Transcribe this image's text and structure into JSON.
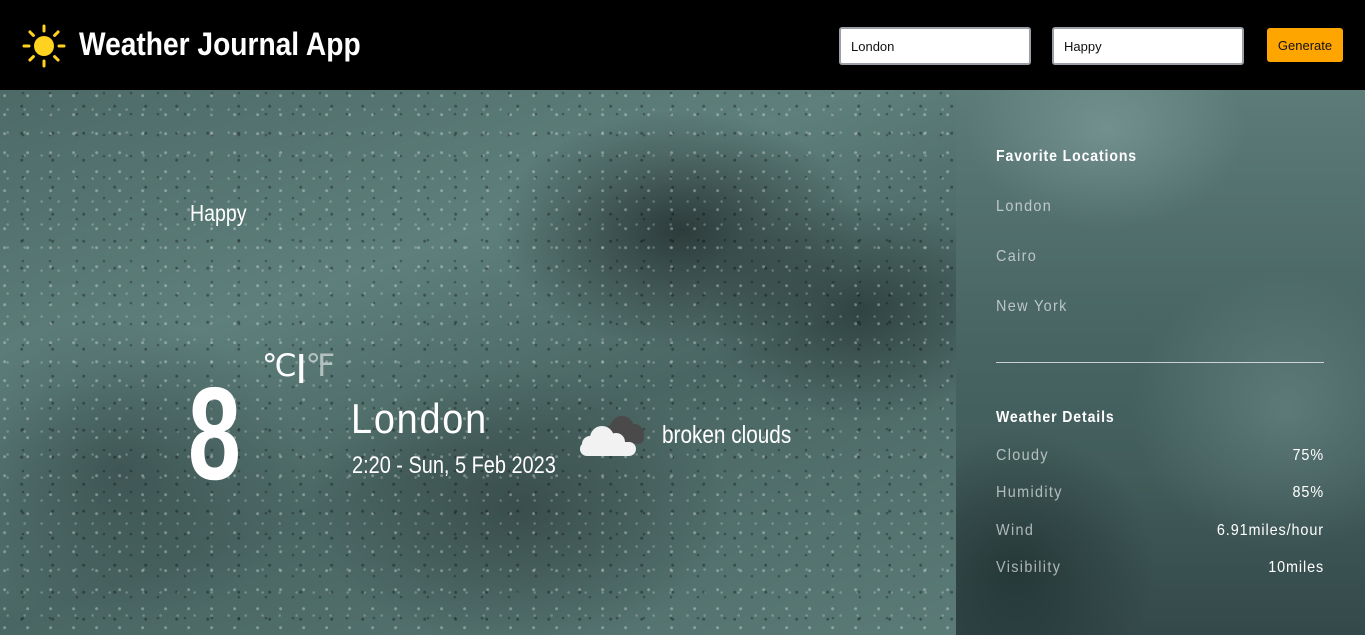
{
  "header": {
    "app_title": "Weather Journal App",
    "city_input_value": "London",
    "feeling_input_value": "Happy",
    "generate_label": "Generate"
  },
  "main": {
    "feeling": "Happy",
    "unit_celsius": "℃",
    "unit_separator": "|",
    "unit_fahrenheit": "℉",
    "temperature": "8",
    "city": "London",
    "datetime": "2:20 - Sun, 5 Feb 2023",
    "condition": "broken clouds",
    "condition_icon": "broken-clouds-icon"
  },
  "sidebar": {
    "favorites_heading": "Favorite Locations",
    "favorites": [
      "London",
      "Cairo",
      "New York"
    ],
    "details_heading": "Weather Details",
    "details": [
      {
        "label": "Cloudy",
        "value": "75%"
      },
      {
        "label": "Humidity",
        "value": "85%"
      },
      {
        "label": "Wind",
        "value": "6.91miles/hour"
      },
      {
        "label": "Visibility",
        "value": "10miles"
      }
    ]
  },
  "colors": {
    "accent": "#ffa500",
    "header_bg": "#000000",
    "sun": "#ffd21f"
  }
}
